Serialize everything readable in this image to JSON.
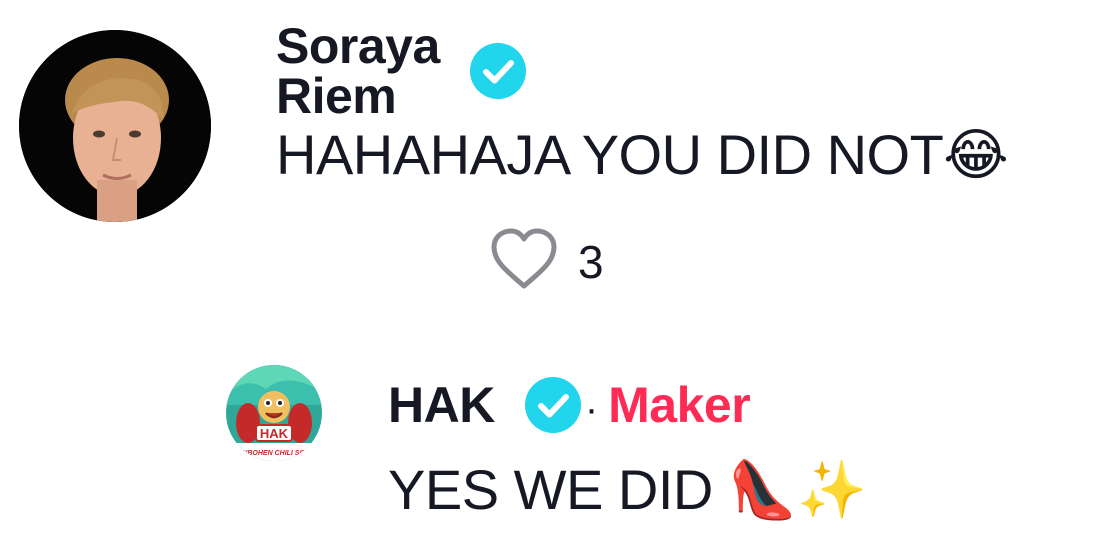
{
  "comment": {
    "author": "Soraya Riem",
    "verified": true,
    "text": "HAHAHAJA YOU DID NOT😂",
    "like_count": "3",
    "like_icon": "heart-outline-icon"
  },
  "reply": {
    "author": "HAK",
    "verified": true,
    "separator": "·",
    "author_tag": "Maker",
    "text": "YES WE DID 👠✨",
    "avatar_label": "HAK",
    "avatar_caption": "HEYBOHEN CHILI SCHO"
  },
  "colors": {
    "verified_badge": "#20d5ec",
    "creator_tag": "#fe2c55",
    "text": "#161823",
    "icon_gray": "#8a8b91"
  }
}
